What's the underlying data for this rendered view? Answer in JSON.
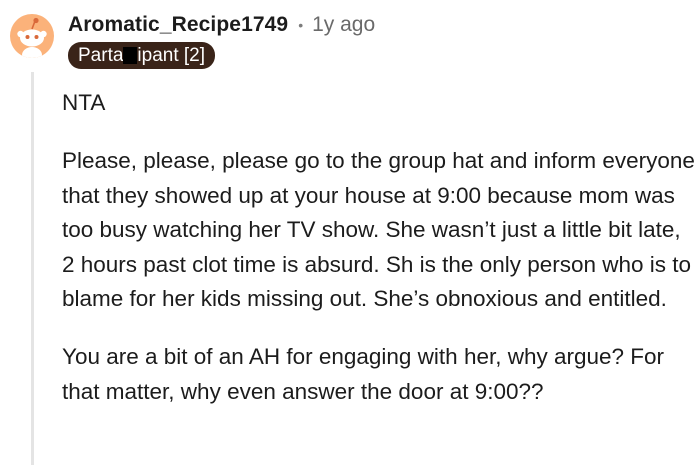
{
  "comment": {
    "username": "Aromatic_Recipe1749",
    "separator": "•",
    "age": "1y ago",
    "flair": {
      "prefix": "Parta",
      "suffix": "ipant [2]"
    },
    "paragraphs": [
      "NTA",
      "Please, please, please go to the group hat and inform everyone that they showed up at your house at 9:00 because mom was too busy watching her TV show. She wasn’t just a little bit late, 2 hours past clot time is absurd. Sh is the only person who is to blame for her kids missing out. She’s obnoxious and entitled.",
      "You are a bit of an AH for engaging with her, why argue? For that matter, why even answer the door at 9:00??"
    ]
  },
  "colors": {
    "avatar_bg": "#fbb27a",
    "flair_bg": "#3a2419",
    "thread_line": "#e4e4e4",
    "meta_text": "#6a6a6a"
  },
  "icons": {
    "avatar": "snoo-avatar-icon"
  }
}
